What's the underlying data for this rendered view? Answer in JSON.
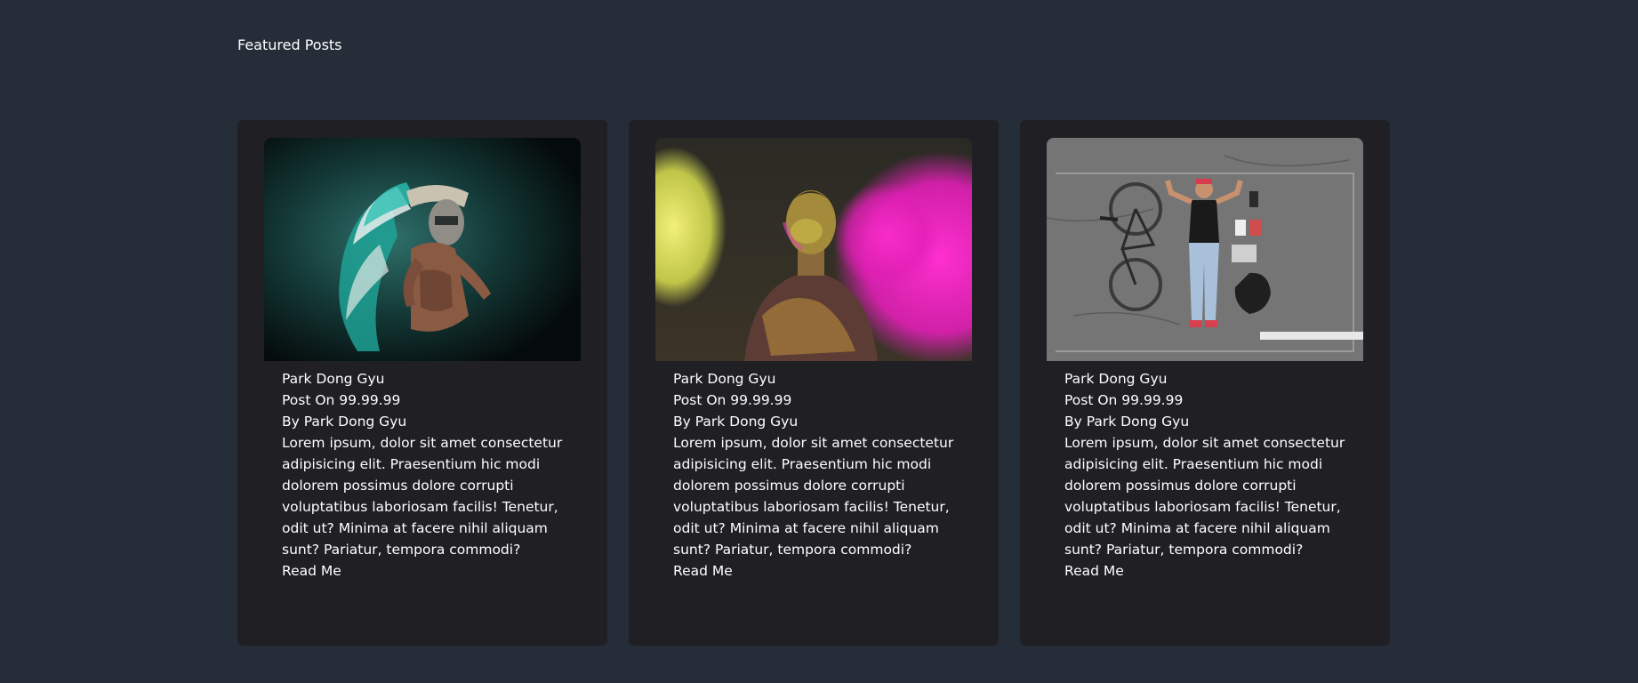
{
  "section": {
    "title": "Featured Posts"
  },
  "cards": [
    {
      "image_icon": "feathered-headdress-photo-icon",
      "name": "Park Dong Gyu",
      "date": "Post On 99.99.99",
      "author": "By Park Dong Gyu",
      "desc": "Lorem ipsum, dolor sit amet consectetur adipisicing elit. Praesentium hic modi dolorem possimus dolore corrupti voluptatibus laboriosam facilis! Tenetur, odit ut? Minima at facere nihil aliquam sunt? Pariatur, tempora commodi?",
      "read_more": "Read Me"
    },
    {
      "image_icon": "color-powder-portrait-photo-icon",
      "name": "Park Dong Gyu",
      "date": "Post On 99.99.99",
      "author": "By Park Dong Gyu",
      "desc": "Lorem ipsum, dolor sit amet consectetur adipisicing elit. Praesentium hic modi dolorem possimus dolore corrupti voluptatibus laboriosam facilis! Tenetur, odit ut? Minima at facere nihil aliquam sunt? Pariatur, tempora commodi?",
      "read_more": "Read Me"
    },
    {
      "image_icon": "flat-lay-bicycle-photo-icon",
      "name": "Park Dong Gyu",
      "date": "Post On 99.99.99",
      "author": "By Park Dong Gyu",
      "desc": "Lorem ipsum, dolor sit amet consectetur adipisicing elit. Praesentium hic modi dolorem possimus dolore corrupti voluptatibus laboriosam facilis! Tenetur, odit ut? Minima at facere nihil aliquam sunt? Pariatur, tempora commodi?",
      "read_more": "Read Me"
    }
  ],
  "colors": {
    "page_bg": "#252d38",
    "card_bg": "#1f1f24",
    "text": "#ffffff"
  }
}
